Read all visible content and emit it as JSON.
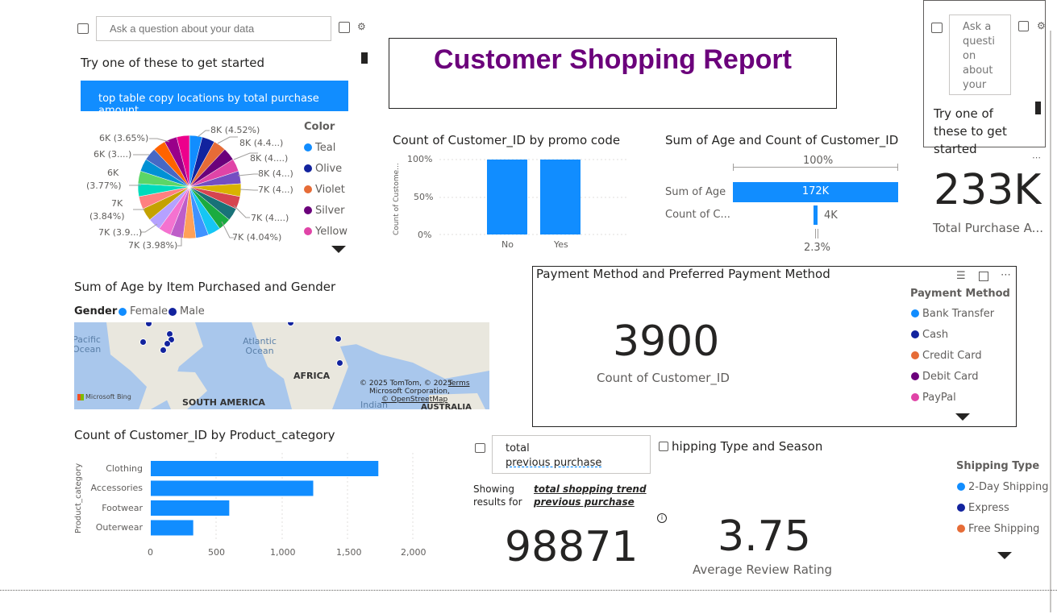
{
  "qa_left": {
    "placeholder": "Ask a question about your data",
    "prompt": "Try one of these to get started",
    "suggestion": "top table copy locations by total purchase amount"
  },
  "qa_right": {
    "placeholder": "Ask a question about your data",
    "prompt": "Try one of these to get started"
  },
  "report_title": "Customer Shopping Report",
  "pie": {
    "legend_title": "Color",
    "legend": [
      {
        "name": "Teal",
        "color": "#118dff"
      },
      {
        "name": "Olive",
        "color": "#12239e"
      },
      {
        "name": "Violet",
        "color": "#e66c37"
      },
      {
        "name": "Silver",
        "color": "#6b007b"
      },
      {
        "name": "Yellow",
        "color": "#e044a7"
      }
    ],
    "labels": [
      "8K (4.52%)",
      "8K (4.4...)",
      "8K (4....)",
      "8K (4...)",
      "7K (4...)",
      "7K (4....)",
      "7K (4.04%)",
      "7K (3.98%)",
      "7K (3.9...)",
      "7K",
      "(3.84%)",
      "6K",
      "(3.77%)",
      "6K (3....)",
      "6K (3.65%)"
    ],
    "slice_colors": [
      "#118dff",
      "#12239e",
      "#e66c37",
      "#6b007b",
      "#e044a7",
      "#744ec2",
      "#d9b300",
      "#d64550",
      "#197278",
      "#1aab40",
      "#15c6f4",
      "#4092ff",
      "#ffa058",
      "#be5dc9",
      "#f472d0",
      "#b5a1ff",
      "#c4a200",
      "#ff8080",
      "#00dbbc",
      "#5bd667",
      "#0091d5",
      "#4668c5",
      "#ff6300",
      "#99008a",
      "#ec008c"
    ],
    "chart_data": {
      "type": "pie",
      "slices_labeled": [
        {
          "label": "8K",
          "pct": 4.52
        },
        {
          "label": "8K",
          "pct": 4.4
        },
        {
          "label": "8K",
          "pct": 4.3
        },
        {
          "label": "8K",
          "pct": 4.2
        },
        {
          "label": "7K",
          "pct": 4.1
        },
        {
          "label": "7K",
          "pct": 4.05
        },
        {
          "label": "7K",
          "pct": 4.04
        },
        {
          "label": "7K",
          "pct": 3.98
        },
        {
          "label": "7K",
          "pct": 3.9
        },
        {
          "label": "7K",
          "pct": 3.84
        },
        {
          "label": "6K",
          "pct": 3.77
        },
        {
          "label": "6K",
          "pct": 3.7
        },
        {
          "label": "6K",
          "pct": 3.65
        }
      ]
    }
  },
  "promo": {
    "title": "Count of Customer_ID by promo code",
    "ylabel": "Count of Custome...",
    "yticks": [
      "100%",
      "50%",
      "0%"
    ],
    "chart_data": {
      "type": "bar",
      "categories": [
        "No",
        "Yes"
      ],
      "values": [
        100,
        100
      ],
      "ylim": [
        0,
        100
      ]
    }
  },
  "funnel": {
    "title": "Sum of Age and Count of Customer_ID",
    "top_pct": "100%",
    "bottom_pct": "2.3%",
    "chart_data": {
      "type": "bar",
      "categories": [
        "Sum of Age",
        "Count of C..."
      ],
      "value_labels": [
        "172K",
        "4K"
      ],
      "values": [
        172000,
        3900
      ]
    }
  },
  "kpi_total_purchase": {
    "value": "233K",
    "label": "Total Purchase A..."
  },
  "map": {
    "title": "Sum of Age by Item Purchased and Gender",
    "legend_title": "Gender",
    "legend": [
      {
        "name": "Female",
        "color": "#118dff"
      },
      {
        "name": "Male",
        "color": "#12239e"
      }
    ],
    "labels": {
      "pacific": "Pacific\nOcean",
      "atlantic": "Atlantic\nOcean",
      "africa": "AFRICA",
      "south_america": "SOUTH AMERICA",
      "indian": "Indian",
      "australia": "AUSTRALIA",
      "attribution": "© 2025 TomTom, © 2025",
      "terms": "Terms",
      "attribution2": "Microsoft Corporation,",
      "osm": "© OpenStreetMap",
      "bing": "Microsoft Bing"
    }
  },
  "payment": {
    "title": "Payment Method and Preferred Payment Method",
    "kpi_value": "3900",
    "kpi_label": "Count of Customer_ID",
    "legend_title": "Payment Method",
    "legend": [
      {
        "name": "Bank Transfer",
        "color": "#118dff"
      },
      {
        "name": "Cash",
        "color": "#12239e"
      },
      {
        "name": "Credit Card",
        "color": "#e66c37"
      },
      {
        "name": "Debit Card",
        "color": "#6b007b"
      },
      {
        "name": "PayPal",
        "color": "#e044a7"
      }
    ]
  },
  "category": {
    "title": "Count of Customer_ID by Product_category",
    "ylabel": "Product_category",
    "xticks": [
      "0",
      "500",
      "1,000",
      "1,500",
      "2,000"
    ],
    "chart_data": {
      "type": "bar",
      "categories": [
        "Clothing",
        "Accessories",
        "Footwear",
        "Outerwear"
      ],
      "values": [
        1737,
        1240,
        599,
        324
      ],
      "xlim": [
        0,
        2000
      ]
    }
  },
  "qa_bottom": {
    "input_line1": "total",
    "input_line2": "previous purchase",
    "showing": "Showing",
    "results_for": "results for",
    "link1": "total shopping trend",
    "link2": "previous purchase",
    "big_value": "98871"
  },
  "shipping": {
    "title_partial": "hipping Type and Season",
    "legend_title": "Shipping Type",
    "legend": [
      {
        "name": "2-Day Shipping",
        "color": "#118dff"
      },
      {
        "name": "Express",
        "color": "#12239e"
      },
      {
        "name": "Free Shipping",
        "color": "#e66c37"
      }
    ]
  },
  "kpi_rating": {
    "value": "3.75",
    "label": "Average Review Rating"
  },
  "colors": {
    "accent": "#118dff",
    "title_purple": "#6b007b"
  }
}
